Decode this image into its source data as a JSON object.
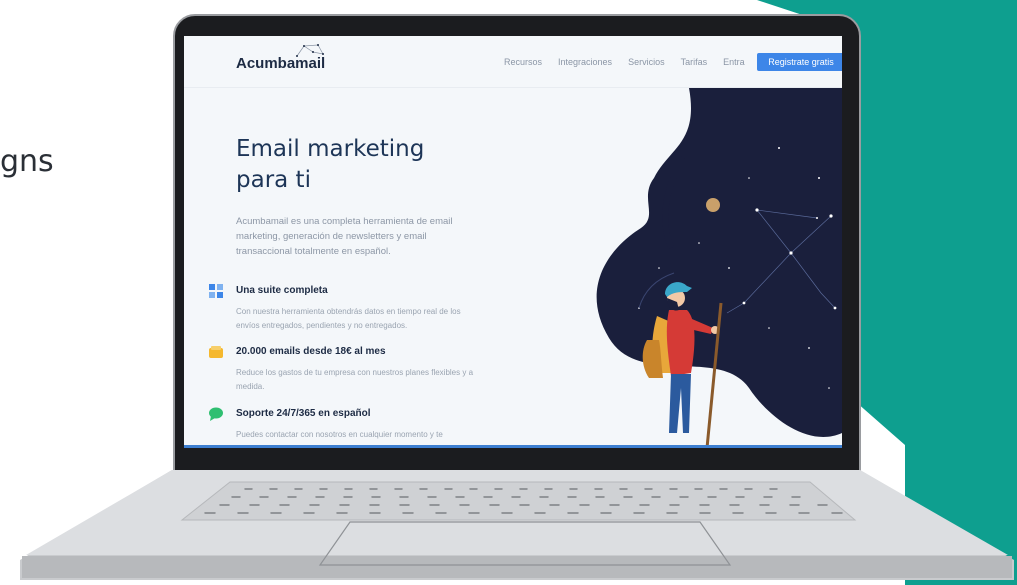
{
  "slide": {
    "partial_text": "gns"
  },
  "site": {
    "logo_text": "Acumbamail",
    "nav_links": [
      "Recursos",
      "Integraciones",
      "Servicios",
      "Tarifas",
      "Entra"
    ],
    "cta_label": "Registrate gratis",
    "hero": {
      "title_line1": "Email marketing",
      "title_line2": "para ti",
      "description": "Acumbamail es una completa herramienta de email marketing, generación de newsletters y email transaccional totalmente en español."
    },
    "features": [
      {
        "icon": "grid-icon",
        "title": "Una suite completa",
        "text": "Con nuestra herramienta obtendrás datos en tiempo real de los envíos entregados, pendientes y no entregados."
      },
      {
        "icon": "wallet-icon",
        "title": "20.000 emails desde 18€ al mes",
        "text": "Reduce los gastos de tu empresa con nuestros planes flexibles y a medida."
      },
      {
        "icon": "chat-icon",
        "title": "Soporte 24/7/365 en español",
        "text": "Puedes contactar con nosotros en cualquier momento y te"
      }
    ]
  },
  "colors": {
    "teal": "#0e9f8f",
    "brand_blue": "#3d86e8",
    "navy": "#1d2b44",
    "night_sky": "#1a1f3c"
  }
}
